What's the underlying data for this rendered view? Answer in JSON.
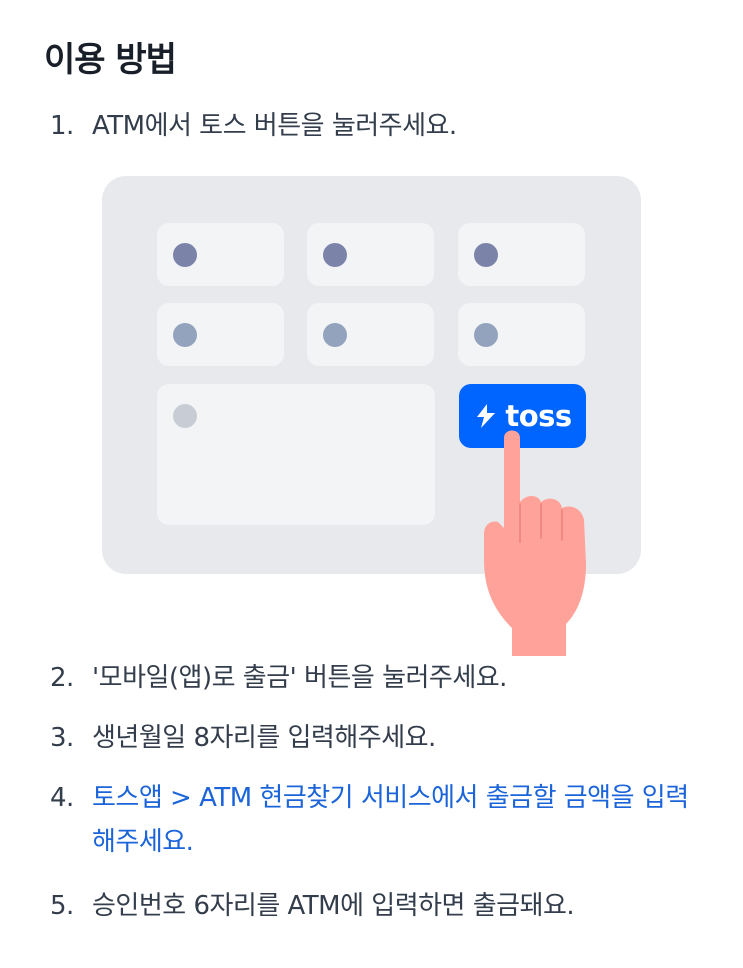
{
  "title": "이용 방법",
  "steps": [
    {
      "num": "1.",
      "text": "ATM에서 토스 버튼을 눌러주세요."
    },
    {
      "num": "2.",
      "text": "'모바일(앱)로 출금' 버튼을 눌러주세요."
    },
    {
      "num": "3.",
      "text": "생년월일 8자리를 입력해주세요."
    },
    {
      "num": "4.",
      "text": "토스앱 > ATM 현금찾기 서비스에서 출금할 금액을 입력해주세요."
    },
    {
      "num": "5.",
      "text": "승인번호 6자리를 ATM에 입력하면 출금돼요."
    }
  ],
  "illustration": {
    "toss_button_label": "toss",
    "colors": {
      "panel": "#e8e9ec",
      "button": "#f3f4f6",
      "toss_blue": "#0064ff",
      "link_blue": "#1b64da",
      "hand": "#ffa39a"
    },
    "icons": [
      "toss-logo-icon",
      "pointing-hand-icon"
    ]
  }
}
